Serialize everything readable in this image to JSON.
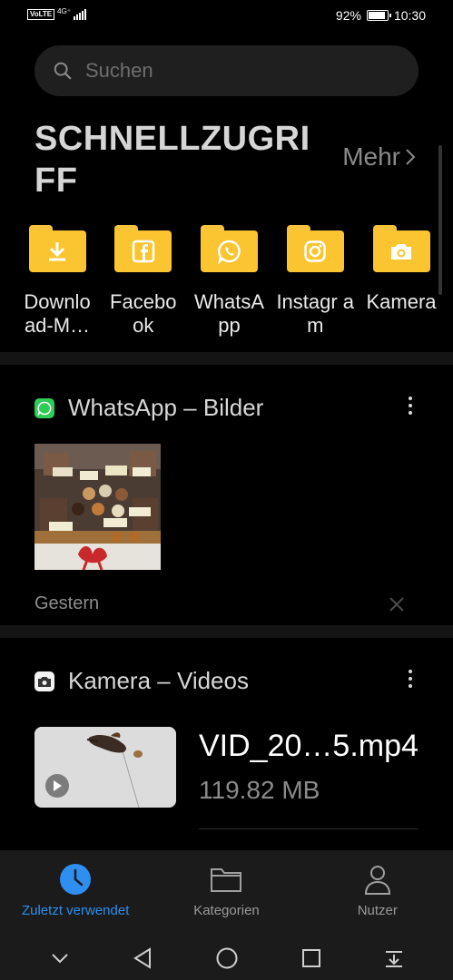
{
  "status_bar": {
    "volte": "VoLTE",
    "network": "4G⁺",
    "battery_percent": "92%",
    "battery_level": 0.92,
    "time": "10:30"
  },
  "search": {
    "placeholder": "Suchen"
  },
  "quick_access": {
    "title": "SCHNELLZUGRIFF",
    "more_label": "Mehr",
    "folders": [
      {
        "label": "Downlo ad-M…",
        "icon": "download-icon"
      },
      {
        "label": "Facebo ok",
        "icon": "facebook-icon"
      },
      {
        "label": "WhatsA pp",
        "icon": "whatsapp-icon"
      },
      {
        "label": "Instagr am",
        "icon": "instagram-icon"
      },
      {
        "label": "Kamera",
        "icon": "camera-icon"
      }
    ],
    "folder_color": "#fbc531"
  },
  "cards": {
    "whatsapp": {
      "title": "WhatsApp – Bilder",
      "badge_color": "#2ecc55",
      "date": "Gestern"
    },
    "camera": {
      "title": "Kamera – Videos",
      "video_name": "VID_20…5.mp4",
      "video_size": "119.82 MB"
    }
  },
  "bottom_nav": {
    "items": [
      {
        "label": "Zuletzt verwendet",
        "icon": "clock-icon",
        "active": true
      },
      {
        "label": "Kategorien",
        "icon": "folder-icon",
        "active": false
      },
      {
        "label": "Nutzer",
        "icon": "user-icon",
        "active": false
      }
    ],
    "accent": "#2e8ff0"
  },
  "system_nav": [
    "chevron-down-icon",
    "back-icon",
    "home-icon",
    "recents-icon",
    "notification-pull-icon"
  ]
}
